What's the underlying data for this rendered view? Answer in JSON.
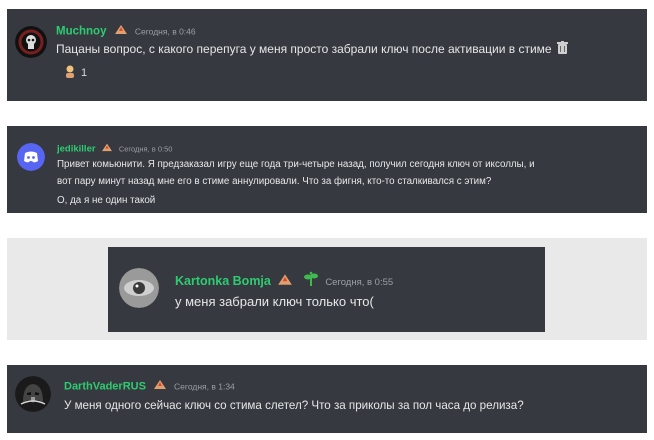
{
  "messages": [
    {
      "author": "Muchnoy",
      "timestamp": "Сегодня, в 0:46",
      "lines": [
        "Пацаны вопрос, с какого перепуга у меня просто забрали ключ после активации в стиме"
      ],
      "reaction_count": "1"
    },
    {
      "author": "jedikiller",
      "timestamp": "Сегодня, в 0:50",
      "lines": [
        "Привет комьюнити. Я предзаказал игру еще года три-четыре назад, получил сегодня ключ от иксоллы, и",
        "вот пару минут назад мне его в стиме аннулировали. Что за фигня, кто-то сталкивался с этим?",
        "О, да я не один такой"
      ]
    },
    {
      "author": "Kartonka Bomja",
      "timestamp": "Сегодня, в 0:55",
      "lines": [
        "у меня забрали ключ только что("
      ]
    },
    {
      "author": "DarthVaderRUS",
      "timestamp": "Сегодня, в 1:34",
      "lines": [
        "У меня одного сейчас ключ со стима слетел? Что за приколы за пол часа до релиза?"
      ]
    }
  ],
  "colors": {
    "panel": "#36393f",
    "name": "#2ecc71",
    "text": "#e6e7e8",
    "timestamp": "#9aa0a6",
    "discord": "#5865f2",
    "gray_bg": "#e9e9e9"
  },
  "icons": {
    "rank_badge": "flame-hand-icon",
    "extra_badge": "sprout-icon",
    "message_tail": "trash-can-icon",
    "reaction": "person-emoji-icon"
  }
}
